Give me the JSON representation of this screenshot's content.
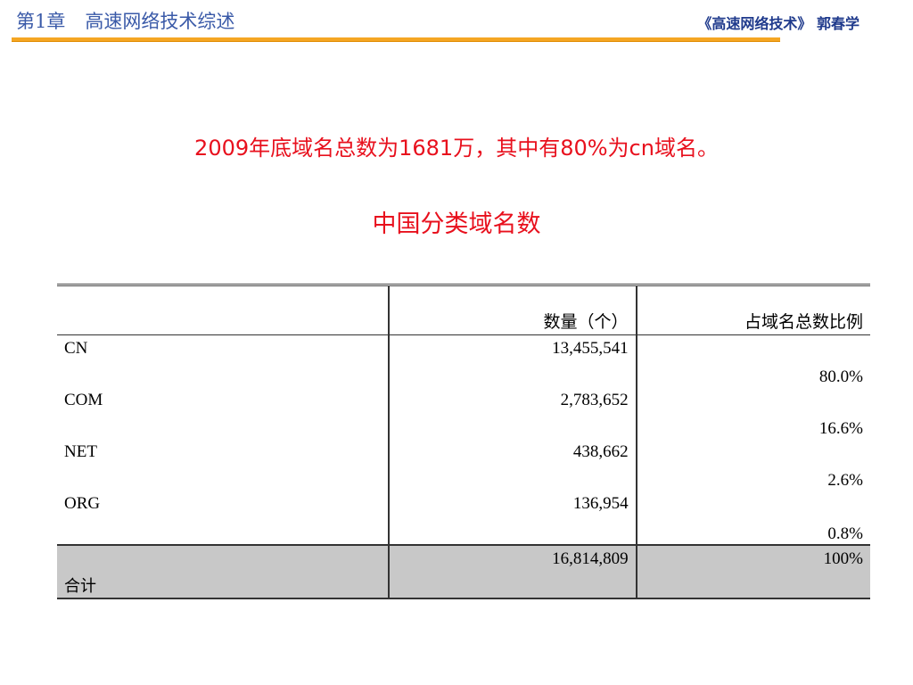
{
  "header": {
    "chapter": "第1章",
    "chapter_title": "高速网络技术综述",
    "book_credit": "《高速网络技术》 郭春学"
  },
  "headline": "2009年底域名总数为1681万，其中有80%为cn域名。",
  "subhead": "中国分类域名数",
  "table": {
    "columns": [
      "",
      "数量（个）",
      "占域名总数比例"
    ],
    "rows": [
      {
        "name": "CN",
        "count": "13,455,541",
        "share": "80.0%"
      },
      {
        "name": "COM",
        "count": "2,783,652",
        "share": "16.6%"
      },
      {
        "name": "NET",
        "count": "438,662",
        "share": "2.6%"
      },
      {
        "name": "ORG",
        "count": "136,954",
        "share": "0.8%"
      }
    ],
    "total": {
      "name": "合计",
      "count": "16,814,809",
      "share": "100%"
    }
  },
  "colors": {
    "header_text": "#3a5aa8",
    "header_rule": "#f5a623",
    "headline_text": "#e8101d",
    "total_row_bg": "#c8c8c8"
  }
}
